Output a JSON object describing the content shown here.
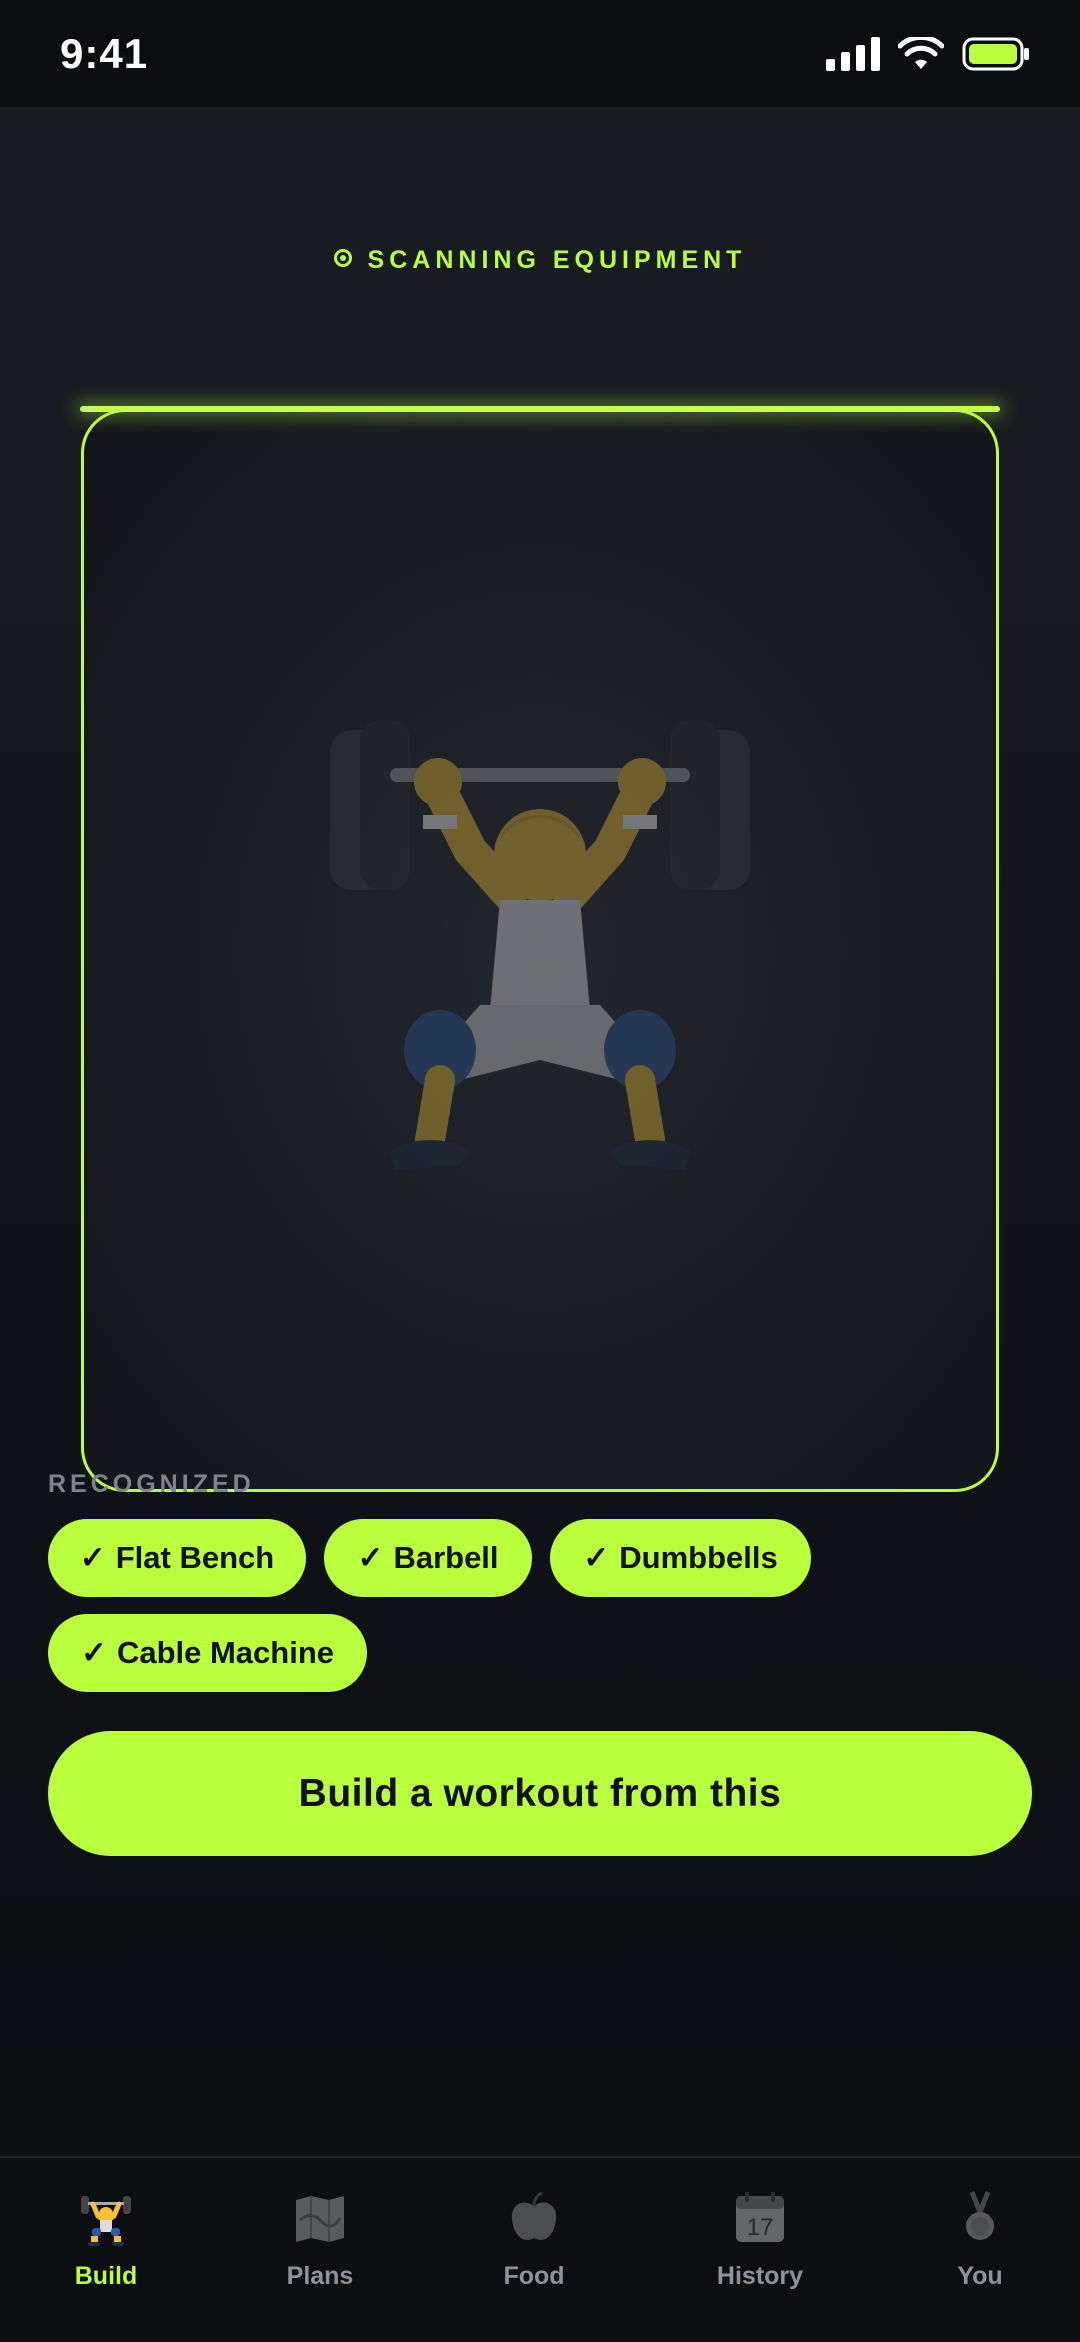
{
  "status_bar": {
    "time": "9:41"
  },
  "scan": {
    "label": "SCANNING EQUIPMENT"
  },
  "recognized": {
    "label": "RECOGNIZED",
    "items": [
      "Flat Bench",
      "Barbell",
      "Dumbbells",
      "Cable Machine"
    ],
    "check": "✓"
  },
  "cta": {
    "label": "Build a workout from this"
  },
  "tabs": [
    {
      "label": "Build",
      "icon": "weightlifter-icon",
      "active": true
    },
    {
      "label": "Plans",
      "icon": "map-icon",
      "active": false
    },
    {
      "label": "Food",
      "icon": "apple-icon",
      "active": false
    },
    {
      "label": "History",
      "icon": "calendar-icon",
      "active": false
    },
    {
      "label": "You",
      "icon": "medal-icon",
      "active": false
    }
  ],
  "calendar_day": "17",
  "colors": {
    "accent": "#b9ff3e",
    "background": "#0b0d11",
    "muted": "#8e939b"
  }
}
